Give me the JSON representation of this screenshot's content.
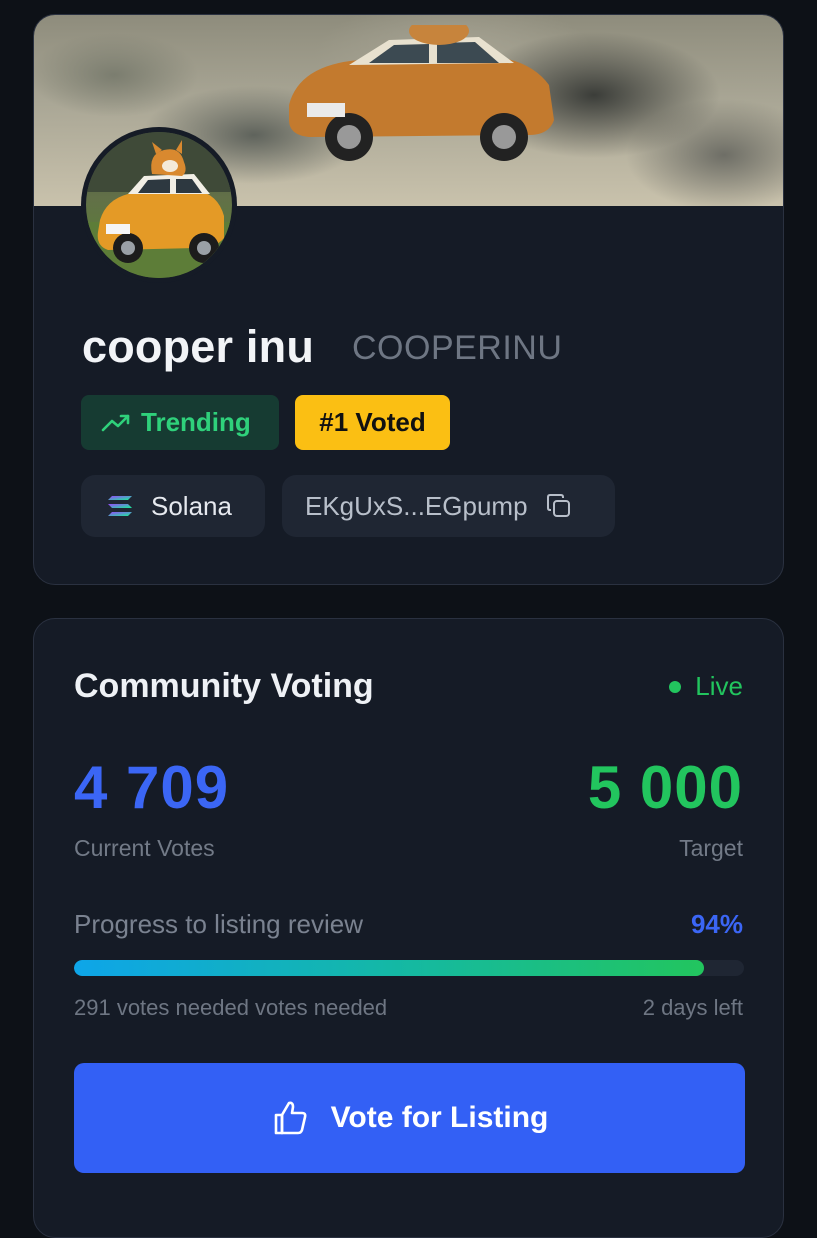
{
  "token": {
    "name": "cooper inu",
    "symbol": "COOPERINU",
    "badges": {
      "trending": "Trending",
      "voted": "#1 Voted"
    },
    "chain": "Solana",
    "address_short": "EKgUxS...EGpump"
  },
  "voting": {
    "title": "Community Voting",
    "status": "Live",
    "current_votes": "4 709",
    "current_label": "Current Votes",
    "target_votes": "5 000",
    "target_label": "Target",
    "progress_label": "Progress to listing review",
    "progress_percent_text": "94%",
    "progress_fraction": 0.94,
    "needed_text": "291 votes needed votes needed",
    "time_left": "2 days left",
    "button_label": "Vote for Listing"
  },
  "colors": {
    "accent_blue": "#3b66f5",
    "accent_green": "#22c55e",
    "badge_yellow": "#fbbf13",
    "card_bg": "#151b26",
    "page_bg": "#0d1117"
  },
  "icons": [
    "trending-up-icon",
    "solana-icon",
    "copy-icon",
    "thumbs-up-icon"
  ]
}
